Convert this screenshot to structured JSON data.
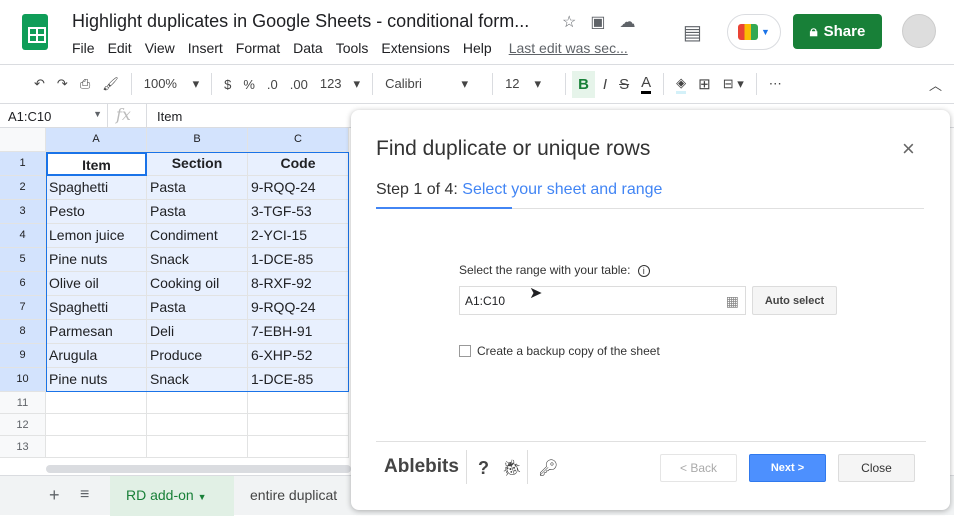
{
  "doc": {
    "title": "Highlight duplicates in Google Sheets - conditional form...",
    "menu": [
      "File",
      "Edit",
      "View",
      "Insert",
      "Format",
      "Data",
      "Tools",
      "Extensions",
      "Help"
    ],
    "last_edit": "Last edit was sec...",
    "share": "Share"
  },
  "toolbar": {
    "zoom": "100%",
    "currency": "$",
    "percent": "%",
    "dec_less": ".0",
    "dec_more": ".00",
    "format": "123",
    "font": "Calibri",
    "size": "12",
    "bold": "B",
    "italic": "I",
    "strike": "S",
    "color": "A",
    "more": "⋯"
  },
  "formula": {
    "namebox": "A1:C10",
    "fx": "fx",
    "value": "Item"
  },
  "columns": [
    "A",
    "B",
    "C"
  ],
  "rows": [
    [
      "Item",
      "Section",
      "Code"
    ],
    [
      "Spaghetti",
      "Pasta",
      "9-RQQ-24"
    ],
    [
      "Pesto",
      "Pasta",
      "3-TGF-53"
    ],
    [
      "Lemon juice",
      "Condiment",
      "2-YCI-15"
    ],
    [
      "Pine nuts",
      "Snack",
      "1-DCE-85"
    ],
    [
      "Olive oil",
      "Cooking oil",
      "8-RXF-92"
    ],
    [
      "Spaghetti",
      "Pasta",
      "9-RQQ-24"
    ],
    [
      "Parmesan",
      "Deli",
      "7-EBH-91"
    ],
    [
      "Arugula",
      "Produce",
      "6-XHP-52"
    ],
    [
      "Pine nuts",
      "Snack",
      "1-DCE-85"
    ]
  ],
  "row_numbers": [
    "1",
    "2",
    "3",
    "4",
    "5",
    "6",
    "7",
    "8",
    "9",
    "10",
    "11",
    "12",
    "13"
  ],
  "dialog": {
    "title": "Find duplicate or unique rows",
    "step": "Step 1 of 4:",
    "step_name": "Select your sheet and range",
    "range_label": "Select the range with your table:",
    "range_value": "A1:C10",
    "auto_select": "Auto select",
    "backup": "Create a backup copy of the sheet",
    "backup_checked": false,
    "brand": "Ablebits",
    "back": "< Back",
    "next": "Next >",
    "close": "Close",
    "accent": "#4285f4"
  },
  "sheets": {
    "active": "RD add-on",
    "other": "entire duplicat"
  }
}
